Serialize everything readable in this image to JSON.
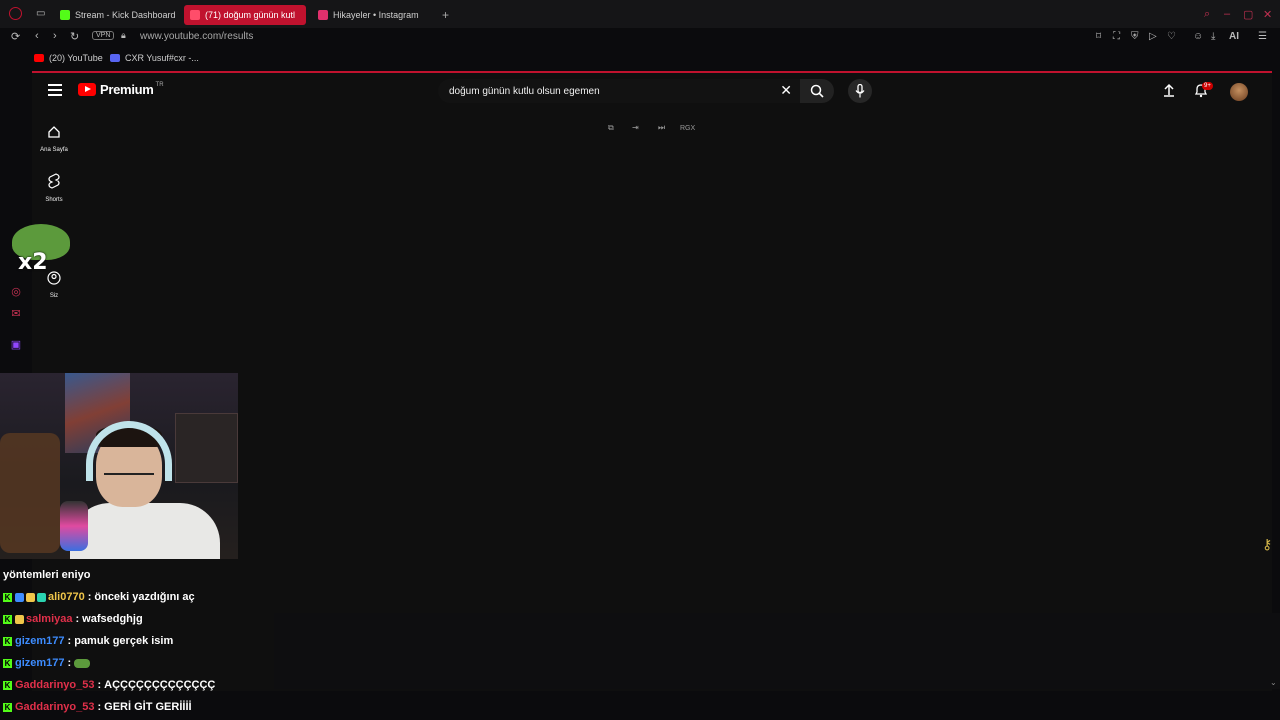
{
  "browser": {
    "tabs": [
      {
        "label": "Stream - Kick Dashboard",
        "fav_color": "#53fc18"
      },
      {
        "label": "(71) doğum günün kutl",
        "fav_color": "#ff0000"
      },
      {
        "label": "Hikayeler • Instagram",
        "fav_color": "#e1306c"
      }
    ],
    "new_tab": "+",
    "vpn": "VPN",
    "url": "www.youtube.com/results",
    "ai_label": "AI",
    "bookmarks": [
      {
        "label": "(20) YouTube",
        "fav_color": "#ff0000"
      },
      {
        "label": "CXR Yusuf#cxr -...",
        "fav_color": "#5865f2"
      }
    ]
  },
  "youtube": {
    "brand": "Premium",
    "region": "TR",
    "search_value": "doğum günün kutlu olsun egemen",
    "notification_badge": "9+",
    "guide": [
      {
        "label": "Ana Sayfa",
        "icon": "home-icon"
      },
      {
        "label": "Shorts",
        "icon": "shorts-icon"
      },
      {
        "label": "Siz",
        "icon": "you-icon"
      }
    ],
    "player_controls": [
      "RGX"
    ]
  },
  "stream_overlay": {
    "emote_text": "x2",
    "chat": [
      {
        "user": "",
        "user_color": "#ff4d4d",
        "text": "yöntemleri eniyo"
      },
      {
        "user": "ali0770",
        "user_color": "#f0c64a",
        "text": "önceki yazdığını aç"
      },
      {
        "user": "salmiyaa",
        "user_color": "#e0304a",
        "text": "wafsedghjg"
      },
      {
        "user": "gizem177",
        "user_color": "#3d8cff",
        "text": "pamuk gerçek isim"
      },
      {
        "user": "gizem177",
        "user_color": "#3d8cff",
        "text": ""
      },
      {
        "user": "Gaddarinyo_53",
        "user_color": "#e0304a",
        "text": "AÇÇÇÇÇÇÇÇÇÇÇÇÇ"
      },
      {
        "user": "Gaddarinyo_53",
        "user_color": "#e0304a",
        "text": "GERİ GİT GERİİİİ"
      }
    ]
  }
}
